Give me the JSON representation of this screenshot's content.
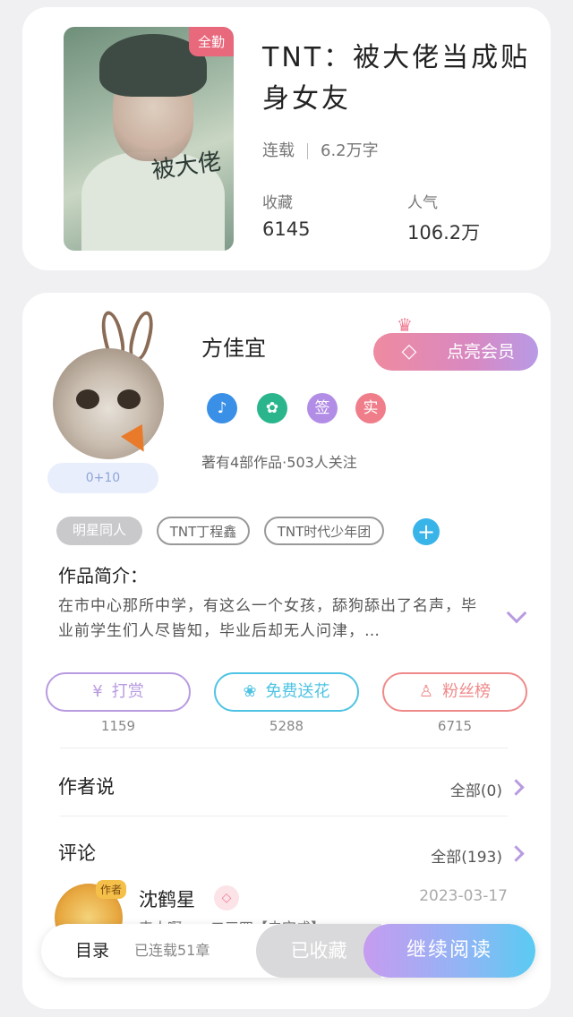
{
  "book": {
    "badge": "全勤",
    "title": "TNT：被大佬当成贴身女友",
    "status": "连载",
    "word_count": "6.2万字",
    "collect_label": "收藏",
    "collect_value": "6145",
    "popularity_label": "人气",
    "popularity_value": "106.2万"
  },
  "author": {
    "name": "方佳宜",
    "level": "0+10",
    "vip_button": "点亮会员",
    "medals": [
      {
        "icon": "music-note-icon",
        "color": "#3a8fe6",
        "text": "♪"
      },
      {
        "icon": "handshake-icon",
        "color": "#2bb58c",
        "text": "✿"
      },
      {
        "icon": "sign-badge-icon",
        "color": "#b28de6",
        "text": "签"
      },
      {
        "icon": "verified-badge-icon",
        "color": "#ef7d8a",
        "text": "实"
      }
    ],
    "works_info": "著有4部作品·503人关注"
  },
  "tags": [
    "明星同人",
    "TNT丁程鑫",
    "TNT时代少年团"
  ],
  "intro": {
    "title": "作品简介：",
    "text": "在市中心那所中学，有这么一个女孩，舔狗舔出了名声，毕业前学生们人尽皆知，毕业后却无人问津，…"
  },
  "actions": [
    {
      "label": "打赏",
      "icon": "¥",
      "count": "1159",
      "color": "#b89be0"
    },
    {
      "label": "免费送花",
      "icon": "❀",
      "count": "5288",
      "color": "#4fc3e3"
    },
    {
      "label": "粉丝榜",
      "icon": "♙",
      "count": "6715",
      "color": "#ef8a8a"
    }
  ],
  "author_says": {
    "title": "作者说",
    "link": "全部(0)"
  },
  "comments": {
    "title": "评论",
    "link": "全部(193)",
    "first": {
      "name": "沈鹤星",
      "avatar_tag": "作者",
      "date": "2023-03-17",
      "text": "来人啊，一二三四【未完成】"
    }
  },
  "bottom": {
    "toc": "目录",
    "chapters": "已连载51章",
    "collected": "已收藏",
    "read": "继续阅读"
  }
}
